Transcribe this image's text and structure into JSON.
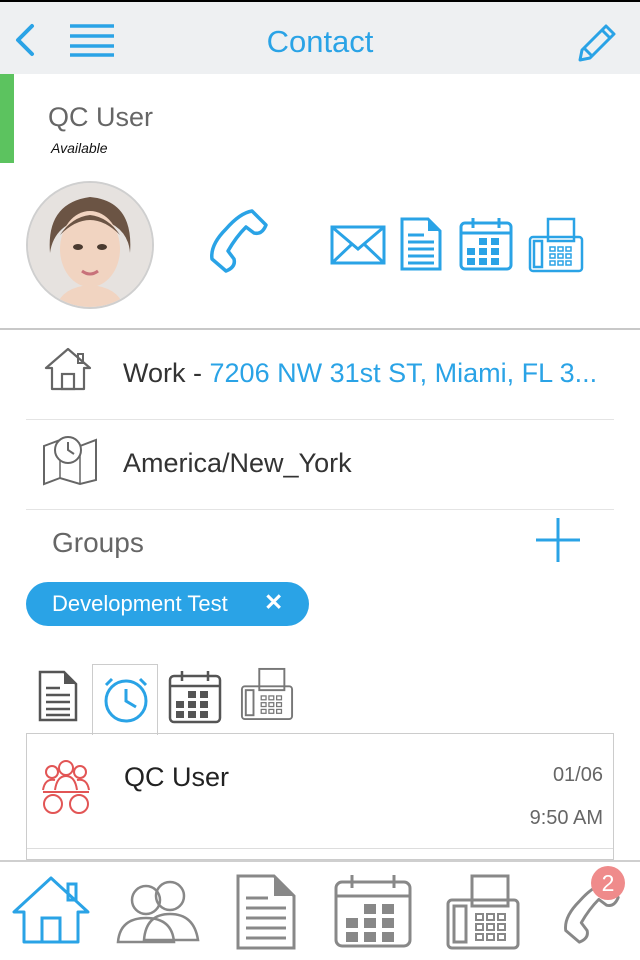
{
  "header": {
    "title": "Contact",
    "back_icon": "chevron-left-icon",
    "menu_icon": "hamburger-menu-icon",
    "edit_icon": "pencil-icon",
    "accent_color": "#2aa3e6"
  },
  "contact": {
    "name": "QC User",
    "status": "Available",
    "status_color": "#5cc35f",
    "avatar": "avatar",
    "actions": [
      "phone-icon",
      "email-icon",
      "document-icon",
      "calendar-icon",
      "fax-icon"
    ]
  },
  "details": {
    "address_type": "Work",
    "address_separator": " - ",
    "address": "7206 NW 31st ST, Miami, FL 3...",
    "timezone": "America/New_York"
  },
  "groups": {
    "title": "Groups",
    "add_icon": "plus-icon",
    "items": [
      {
        "label": "Development Test",
        "remove": "✕"
      }
    ]
  },
  "history_tabs": [
    {
      "icon": "document-icon",
      "active": false
    },
    {
      "icon": "clock-icon",
      "active": true
    },
    {
      "icon": "calendar-icon",
      "active": false
    },
    {
      "icon": "fax-icon",
      "active": false
    }
  ],
  "history": [
    {
      "name": "QC User",
      "date": "01/06",
      "time": "9:50 AM",
      "icon": "group-call-icon"
    }
  ],
  "bottom_nav": {
    "items": [
      "home-icon",
      "contacts-icon",
      "documents-icon",
      "calendar-icon",
      "fax-icon",
      "phone-icon"
    ],
    "active": "home-icon",
    "badge": "2",
    "badge_color": "#ef8b8b"
  }
}
